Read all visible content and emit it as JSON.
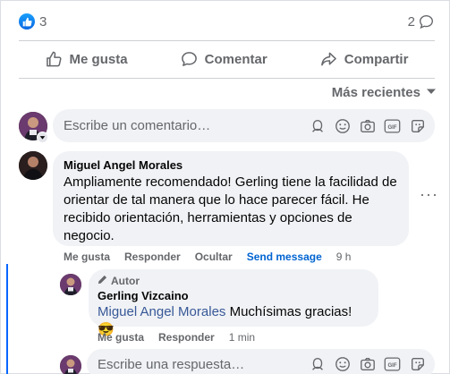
{
  "reactions": {
    "like_count": "3",
    "comment_count": "2"
  },
  "actions": {
    "like": "Me gusta",
    "comment": "Comentar",
    "share": "Compartir"
  },
  "sort": {
    "label": "Más recientes"
  },
  "composer": {
    "placeholder": "Escribe un comentario…"
  },
  "comment": {
    "author": "Miguel Angel Morales",
    "text": "Ampliamente recomendado! Gerling tiene la facilidad de orientar de tal manera que lo hace parecer fácil. He recibido orientación, herramientas y opciones de negocio.",
    "actions": {
      "like": "Me gusta",
      "reply": "Responder",
      "hide": "Ocultar",
      "send": "Send message",
      "time": "9 h"
    }
  },
  "reply": {
    "badge": "Autor",
    "author": "Gerling Vizcaino",
    "mention": "Miguel Angel Morales",
    "text": "Muchísimas gracias! 😎",
    "actions": {
      "like": "Me gusta",
      "reply": "Responder",
      "time": "1 min"
    }
  },
  "reply_composer": {
    "placeholder": "Escribe una respuesta…"
  },
  "colors": {
    "accent": "#0866ff",
    "bubble": "#f0f2f5",
    "muted": "#65676b"
  }
}
